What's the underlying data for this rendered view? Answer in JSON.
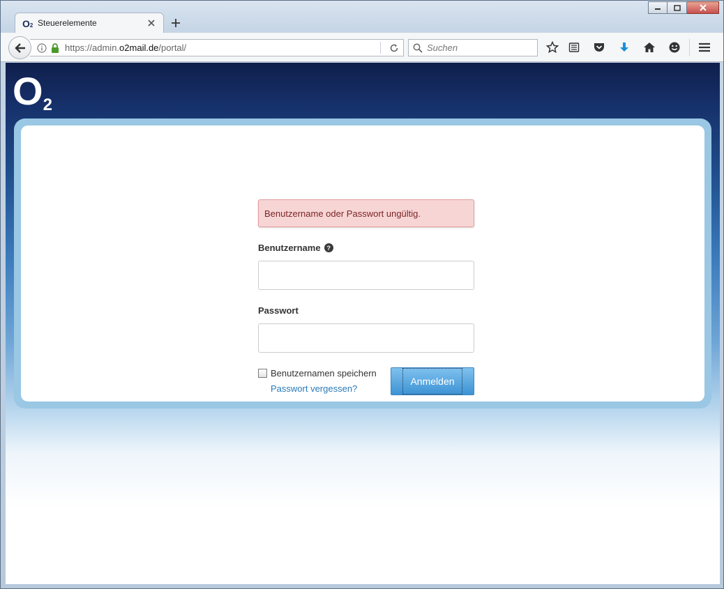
{
  "window": {
    "controls": {
      "minimize": "minimize-icon",
      "maximize": "maximize-icon",
      "close": "close-icon"
    }
  },
  "tabs": [
    {
      "title": "Steuerelemente",
      "favicon": "O",
      "favicon_sub": "2",
      "active": true
    }
  ],
  "navbar": {
    "url_prefix": "https://admin.",
    "url_host": "o2mail.de",
    "url_path": "/portal/",
    "search_placeholder": "Suchen"
  },
  "page": {
    "logo": {
      "letter": "O",
      "sub": "2"
    },
    "alert": "Benutzername oder Passwort ungültig.",
    "username_label": "Benutzername",
    "help_glyph": "?",
    "password_label": "Passwort",
    "username_value": "",
    "password_value": "",
    "remember_label": "Benutzernamen speichern",
    "forgot_link": "Passwort vergessen?",
    "login_button": "Anmelden"
  },
  "colors": {
    "accent_blue": "#3d93d4",
    "alert_bg": "#f8d5d5",
    "alert_text": "#7a2525",
    "link": "#2a7ab8",
    "frame": "#9ac7e4"
  }
}
